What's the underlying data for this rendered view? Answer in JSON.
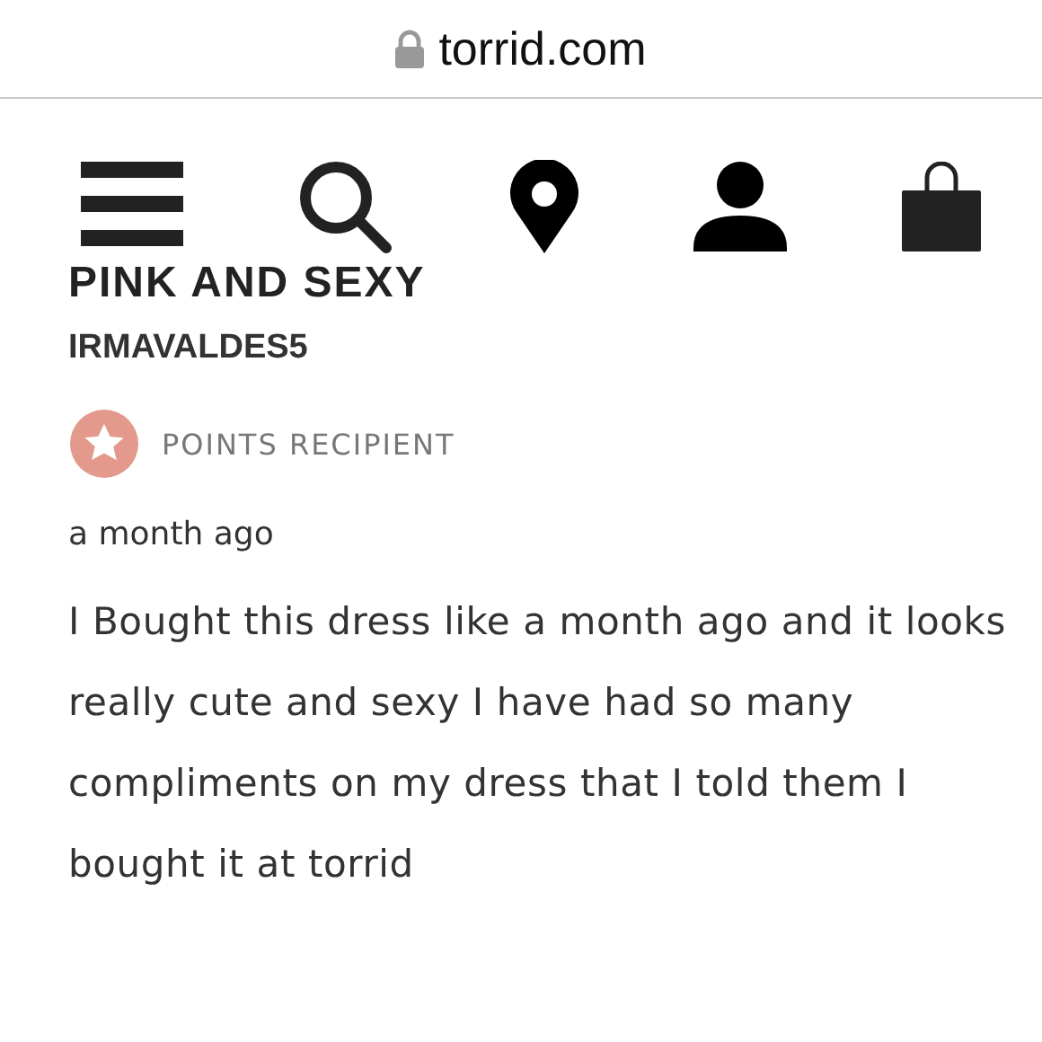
{
  "address_bar": {
    "url": "torrid.com",
    "secure": true
  },
  "review": {
    "title": "PINK AND SEXY",
    "author": "IRMAVALDES5",
    "badge": "POINTS RECIPIENT",
    "time": "a month ago",
    "body": "I Bought this dress like a month ago and it looks really cute and sexy I have had so many compliments on my dress that I told them I bought it at torrid"
  }
}
